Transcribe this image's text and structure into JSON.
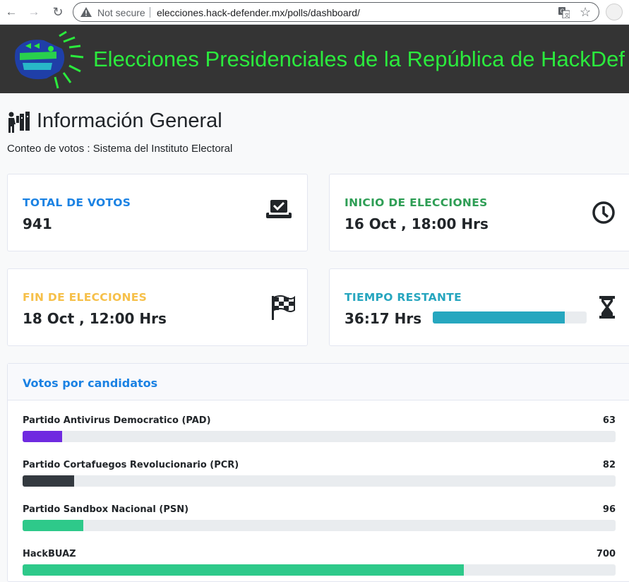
{
  "browser": {
    "not_secure": "Not secure",
    "url": "elecciones.hack-defender.mx/polls/dashboard/"
  },
  "banner": {
    "title": "Elecciones Presidenciales de la República de HackDef",
    "title_color": "#2bea3d",
    "background": "#343434"
  },
  "page": {
    "title": "Información General",
    "subtitle": "Conteo de votos : Sistema del Instituto Electoral"
  },
  "cards": [
    {
      "label": "TOTAL DE VOTOS",
      "value": "941",
      "icon": "ballot-box-icon",
      "color": "#1b82e3"
    },
    {
      "label": "INICIO DE ELECCIONES",
      "value": "16 Oct , 18:00 Hrs",
      "icon": "clock-icon",
      "color": "#2e9e55"
    },
    {
      "label": "FIN DE ELECCIONES",
      "value": "18 Oct , 12:00 Hrs",
      "icon": "checkered-flag-icon",
      "color": "#f6c04a"
    },
    {
      "label": "TIEMPO RESTANTE",
      "value": "36:17 Hrs",
      "icon": "hourglass-icon",
      "color": "#27a6bf",
      "progress": 0.86
    }
  ],
  "votes": {
    "title": "Votos por candidatos",
    "total": 941,
    "candidates": [
      {
        "name": "Partido Antivirus Democratico (PAD)",
        "count": "63",
        "votes": 63,
        "color": "#6f2ae0"
      },
      {
        "name": "Partido Cortafuegos Revolucionario (PCR)",
        "count": "82",
        "votes": 82,
        "color": "#343a40"
      },
      {
        "name": "Partido Sandbox Nacional (PSN)",
        "count": "96",
        "votes": 96,
        "color": "#2ec98a"
      },
      {
        "name": "HackBUAZ",
        "count": "700",
        "votes": 700,
        "color": "#2ec98a"
      }
    ]
  }
}
